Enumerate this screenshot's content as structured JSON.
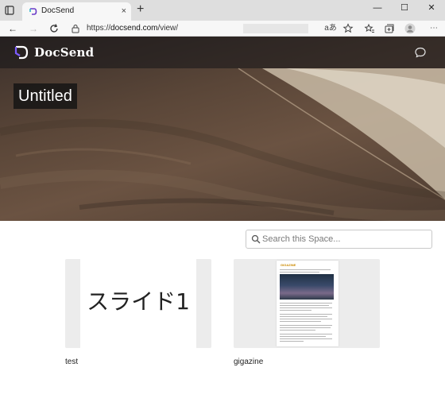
{
  "browser": {
    "tab_title": "DocSend",
    "tab_close": "×",
    "new_tab": "+",
    "url_prefix": "https://",
    "url_host": "docsend.com",
    "url_path": "/view/",
    "window_buttons": {
      "minimize": "—",
      "maximize": "☐",
      "close": "✕"
    },
    "reader_label": "aあ"
  },
  "site": {
    "logo_text": "DocSend",
    "space_title": "Untitled",
    "search_placeholder": "Search this Space..."
  },
  "documents": [
    {
      "name": "test",
      "thumbnail_text": "スライド1"
    },
    {
      "name": "gigazine",
      "thumbnail_brand": "GIGAZINE"
    }
  ]
}
